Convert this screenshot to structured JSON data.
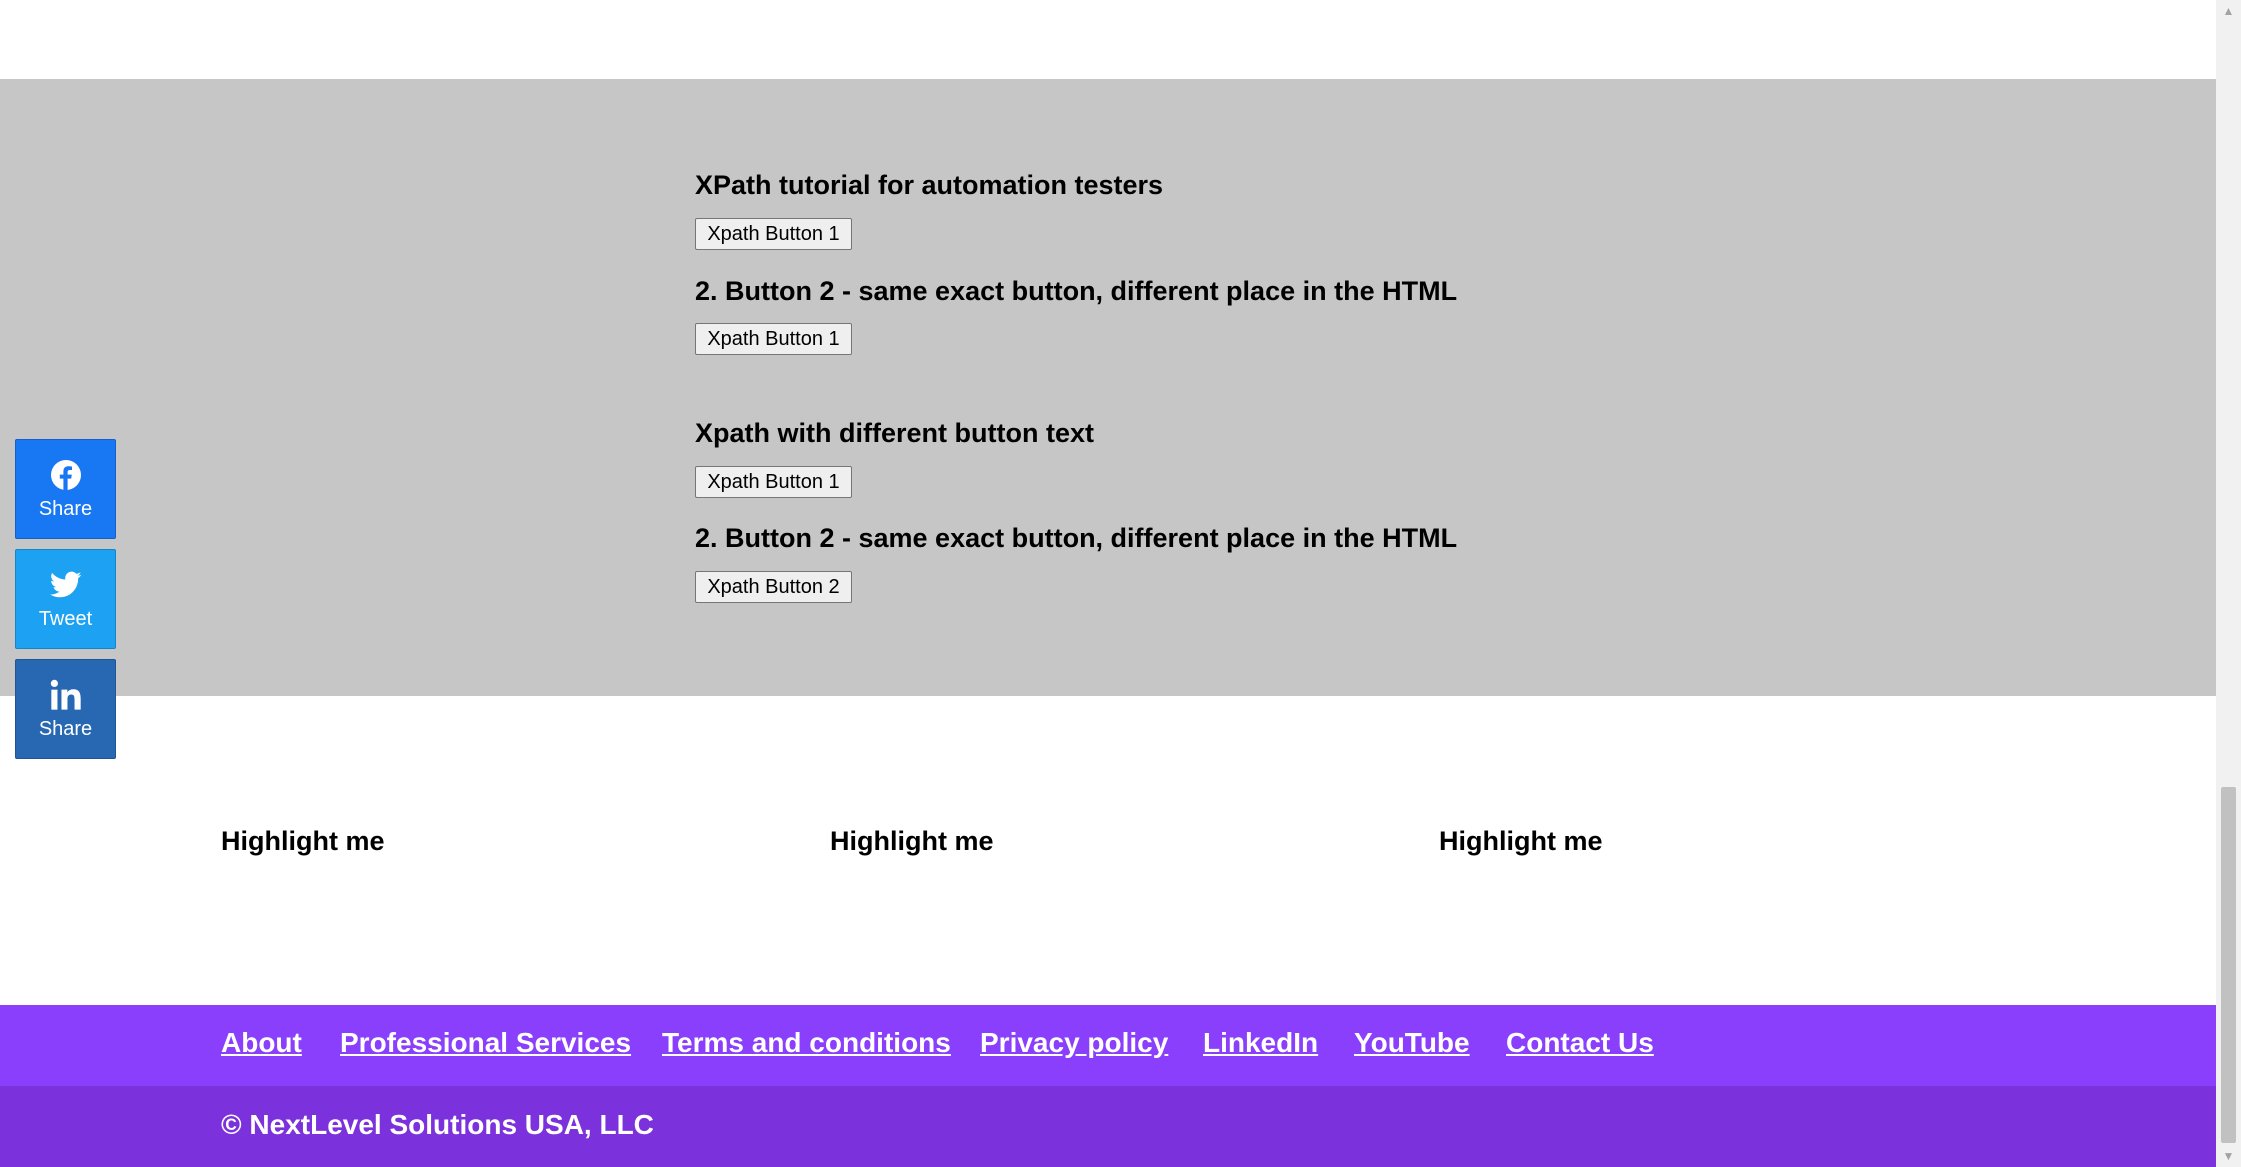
{
  "sections": [
    {
      "heading": "XPath tutorial for automation testers",
      "button": "Xpath Button 1"
    },
    {
      "heading": "2. Button 2 - same exact button, different place in the HTML",
      "button": "Xpath Button 1"
    },
    {
      "heading": "Xpath with different button text",
      "button": "Xpath Button 1"
    },
    {
      "heading": "2. Button 2 - same exact button, different place in the HTML",
      "button": "Xpath Button 2"
    }
  ],
  "social": [
    {
      "label": "Share",
      "icon": "facebook-icon",
      "color": "#1877f2"
    },
    {
      "label": "Tweet",
      "icon": "twitter-icon",
      "color": "#1da1f2"
    },
    {
      "label": "Share",
      "icon": "linkedin-icon",
      "color": "#2867b2"
    }
  ],
  "highlights": [
    "Highlight me",
    "Highlight me",
    "Highlight me"
  ],
  "footer": {
    "links": [
      "About",
      "Professional Services",
      "Terms and conditions",
      "Privacy policy",
      "LinkedIn",
      "YouTube",
      "Contact Us"
    ],
    "copyright": "© NextLevel Solutions USA, LLC"
  },
  "colors": {
    "section_bg": "#c6c6c6",
    "footer_links_bg": "#8a3ffc",
    "footer_copy_bg": "#7b32dc"
  }
}
